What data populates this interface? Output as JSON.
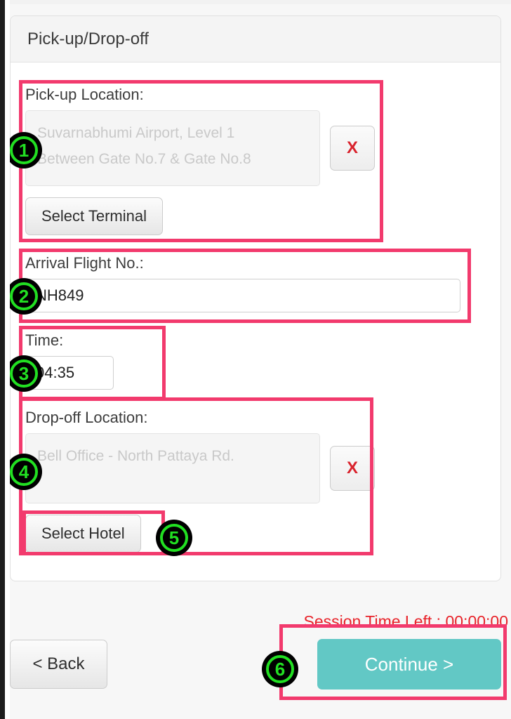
{
  "card": {
    "title": "Pick-up/Drop-off"
  },
  "pickup": {
    "label": "Pick-up Location:",
    "placeholder": "Suvarnabhumi Airport, Level 1\nBetween Gate No.7 & Gate No.8",
    "placeholder_line1": "Suvarnabhumi Airport, Level 1",
    "placeholder_line2": "Between Gate No.7 & Gate No.8",
    "value": "",
    "clear_label": "X",
    "select_button": "Select Terminal"
  },
  "flight": {
    "label": "Arrival Flight No.:",
    "value": "NH849",
    "placeholder": ""
  },
  "time": {
    "label": "Time:",
    "value": "04:35",
    "placeholder": ""
  },
  "dropoff": {
    "label": "Drop-off Location:",
    "placeholder": "Bell Office - North Pattaya Rd.",
    "value": "",
    "clear_label": "X",
    "select_button": "Select Hotel"
  },
  "footer": {
    "back_label": "< Back",
    "continue_label": "Continue >",
    "session_time_text": "Session Time Left : 00:00:00"
  },
  "annotations": {
    "markers": [
      {
        "number": "1"
      },
      {
        "number": "2"
      },
      {
        "number": "3"
      },
      {
        "number": "4"
      },
      {
        "number": "5"
      },
      {
        "number": "6"
      }
    ],
    "box_color": "#f23a6d",
    "marker_color": "#22e022"
  },
  "colors": {
    "accent_teal": "#62c8c5",
    "danger_red": "#d9232d",
    "session_red": "#e8232a",
    "card_header_bg": "#f4f4f4",
    "page_bg": "#f7f7f7"
  }
}
